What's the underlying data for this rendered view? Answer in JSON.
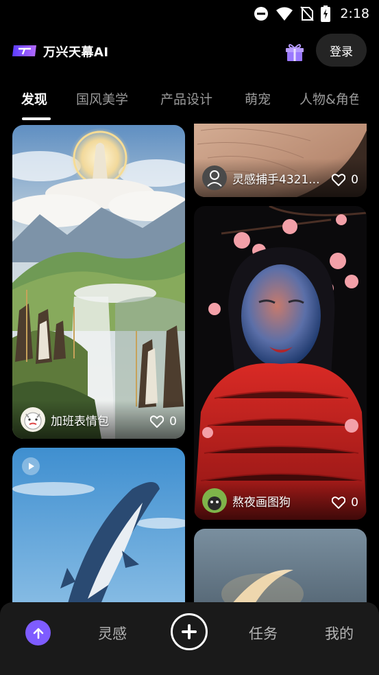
{
  "status_bar": {
    "time": "2:18"
  },
  "header": {
    "app_title": "万兴天幕AI",
    "login_label": "登录"
  },
  "tabs": [
    "发现",
    "国风美学",
    "产品设计",
    "萌宠",
    "人物&角色"
  ],
  "feed": [
    {
      "author": "加班表情包",
      "likes": "0",
      "art": "fantasy-mountains"
    },
    {
      "author": "灵感捕手4321...",
      "likes": "0",
      "art": "skin-closeup"
    },
    {
      "author": "熬夜画图狗",
      "likes": "0",
      "art": "portrait-red-scarf"
    },
    {
      "author": "",
      "likes": "",
      "art": "whale-sky",
      "video": true
    },
    {
      "author": "",
      "likes": "",
      "art": "crescent-moon"
    }
  ],
  "bottom_nav": {
    "inspire": "灵感",
    "tasks": "任务",
    "mine": "我的"
  },
  "colors": {
    "accent": "#7e5cff",
    "background": "#000000",
    "nav_bg": "#1a1a1a"
  }
}
